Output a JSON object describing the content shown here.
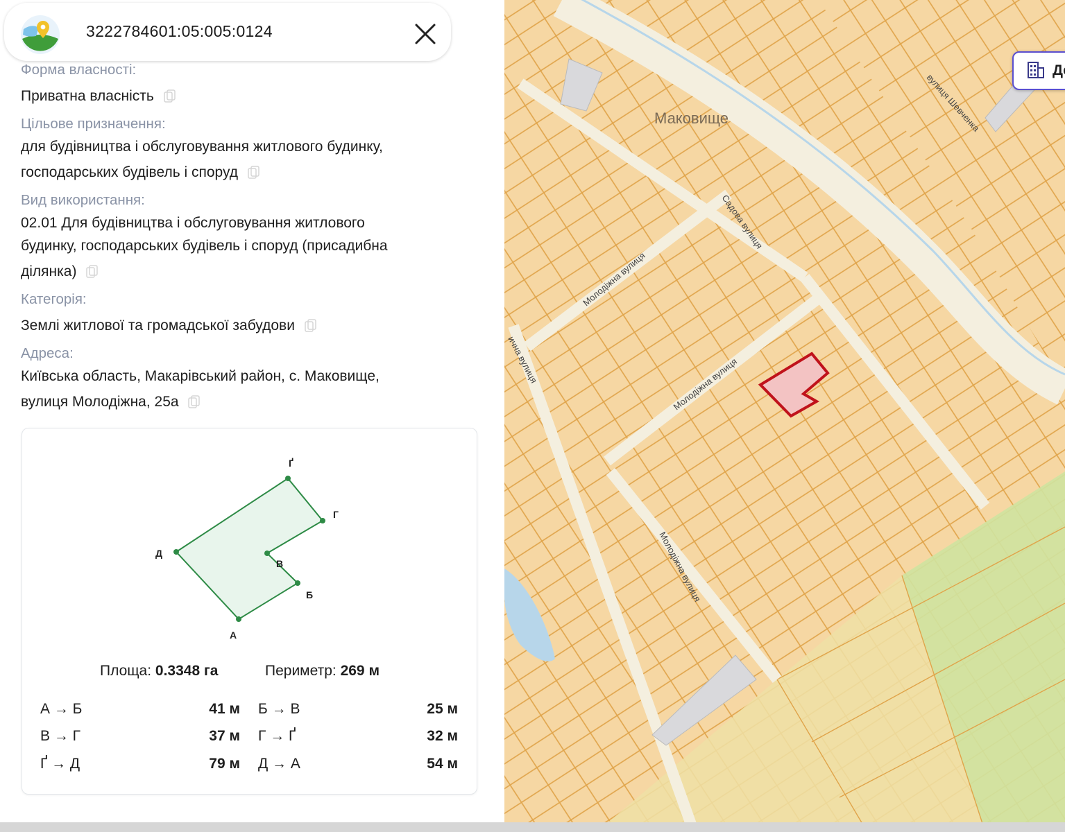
{
  "header": {
    "cadastral_number": "3222784601:05:005:0124",
    "logo_icon": "map-pin-globe-icon",
    "close_icon": "close-icon"
  },
  "details": {
    "ownership_label": "Форма власності:",
    "ownership_value": "Приватна власність",
    "purpose_label": "Цільове призначення:",
    "purpose_value_line1": "для будівництва і обслуговування житлового будинку,",
    "purpose_value_line2": "господарських будівель і споруд",
    "usage_label": "Вид використання:",
    "usage_value_line1": "02.01 Для будівництва і обслуговування житлового",
    "usage_value_line2": "будинку, господарських будівель і споруд (присадибна",
    "usage_value_line3": "ділянка)",
    "category_label": "Категорія:",
    "category_value": "Землі житлової та громадської забудови",
    "address_label": "Адреса:",
    "address_value_line1": "Київська область, Макарівський район, с. Маковище,",
    "address_value_line2": "вулиця Молодіжна, 25а",
    "copy_icon": "copy-icon"
  },
  "plan": {
    "vertices": [
      "А",
      "Б",
      "В",
      "Г",
      "Ґ",
      "Д"
    ],
    "area_label": "Площа:",
    "area_value": "0.3348 га",
    "perimeter_label": "Периметр:",
    "perimeter_value": "269 м",
    "segments": [
      {
        "name": "А → Б",
        "length": "41 м"
      },
      {
        "name": "Б → В",
        "length": "25 м"
      },
      {
        "name": "В → Г",
        "length": "37 м"
      },
      {
        "name": "Г → Ґ",
        "length": "32 м"
      },
      {
        "name": "Ґ → Д",
        "length": "79 м"
      },
      {
        "name": "Д → А",
        "length": "54 м"
      }
    ]
  },
  "map": {
    "village_label": "Маковище",
    "streets": [
      "Молодіжна вулиця",
      "Садова вулиця",
      "вулиця Шевченка",
      "Молодіжна вулиця",
      "Молодіжна вулиця",
      "ична вулиця"
    ],
    "layer_button_icon": "building-icon",
    "layer_button_label": "Де",
    "colors": {
      "parcel_fill": "#f6d7a3",
      "parcel_stroke": "#e0a44a",
      "selected_parcel": "#c0121b",
      "river": "#b7d6ea",
      "green_zone": "#cfe3a0"
    }
  }
}
